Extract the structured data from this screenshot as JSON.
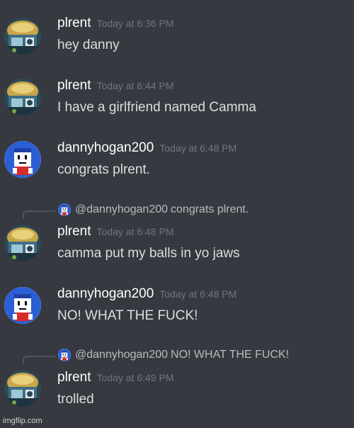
{
  "messages": [
    {
      "username": "plrent",
      "timestamp": "Today at 6:36 PM",
      "content": "hey danny",
      "avatar": "plrent-avatar"
    },
    {
      "username": "plrent",
      "timestamp": "Today at 6:44 PM",
      "content": "I have a girlfriend named Camma",
      "avatar": "plrent-avatar"
    },
    {
      "username": "dannyhogan200",
      "timestamp": "Today at 6:48 PM",
      "content": "congrats plrent.",
      "avatar": "danny-avatar"
    },
    {
      "reply": {
        "mention": "@dannyhogan200",
        "text": "congrats plrent."
      },
      "username": "plrent",
      "timestamp": "Today at 6:48 PM",
      "content": "camma put my balls in yo jaws",
      "avatar": "plrent-avatar"
    },
    {
      "username": "dannyhogan200",
      "timestamp": "Today at 6:48 PM",
      "content": "NO! WHAT THE FUCK!",
      "avatar": "danny-avatar"
    },
    {
      "reply": {
        "mention": "@dannyhogan200",
        "text": "NO! WHAT THE FUCK!"
      },
      "username": "plrent",
      "timestamp": "Today at 6:49 PM",
      "content": "trolled",
      "avatar": "plrent-avatar"
    }
  ],
  "watermark": "imgflip.com",
  "colors": {
    "background": "#36393f",
    "username": "#ffffff",
    "timestamp": "#72767d",
    "content": "#dcddde",
    "reply_line": "#4f545c"
  }
}
